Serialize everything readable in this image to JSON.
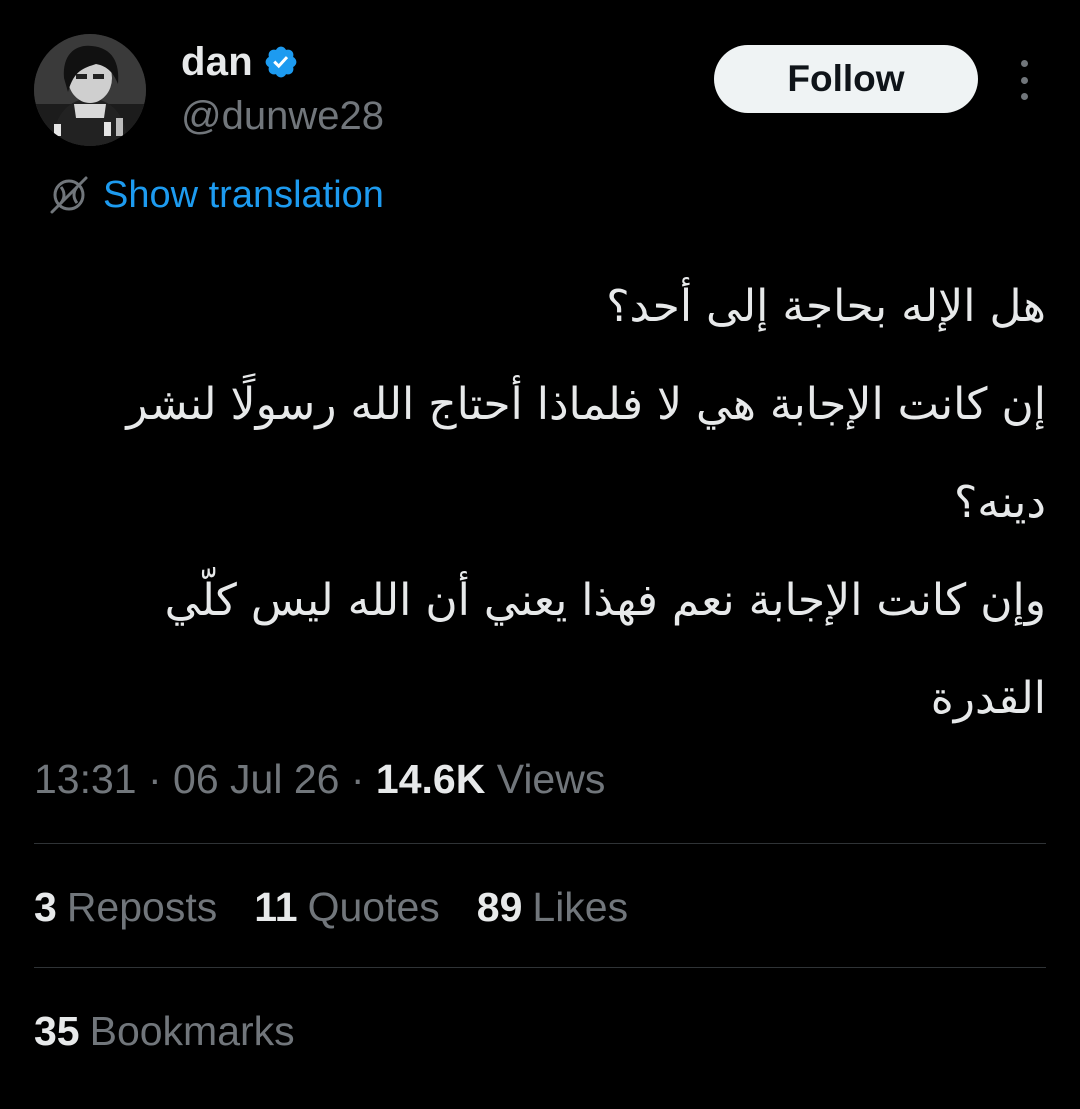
{
  "author": {
    "display_name": "dan",
    "handle": "@dunwe28",
    "verified_icon": "verified-badge-icon",
    "avatar_icon": "avatar-image"
  },
  "actions": {
    "follow_label": "Follow",
    "more_icon": "more-options-icon"
  },
  "translation": {
    "icon": "translate-globe-icon",
    "label": "Show translation"
  },
  "tweet": {
    "lines": [
      "هل الإله بحاجة إلى أحد؟",
      "إن كانت الإجابة هي لا فلماذا أحتاج الله رسولًا لنشر",
      "دينه؟",
      "وإن كانت الإجابة نعم فهذا يعني أن الله ليس كلّي",
      "القدرة"
    ]
  },
  "meta": {
    "time": "13:31",
    "separator": " · ",
    "date": "06 Jul 26",
    "views_count": "14.6K",
    "views_label": "Views"
  },
  "stats": {
    "reposts_count": "3",
    "reposts_label": "Reposts",
    "quotes_count": "11",
    "quotes_label": "Quotes",
    "likes_count": "89",
    "likes_label": "Likes",
    "bookmarks_count": "35",
    "bookmarks_label": "Bookmarks"
  },
  "colors": {
    "background": "#000000",
    "text_primary": "#e7e9ea",
    "text_secondary": "#71767b",
    "accent_blue": "#1d9bf0",
    "divider": "#2f3336",
    "follow_button_bg": "#eff3f4"
  }
}
